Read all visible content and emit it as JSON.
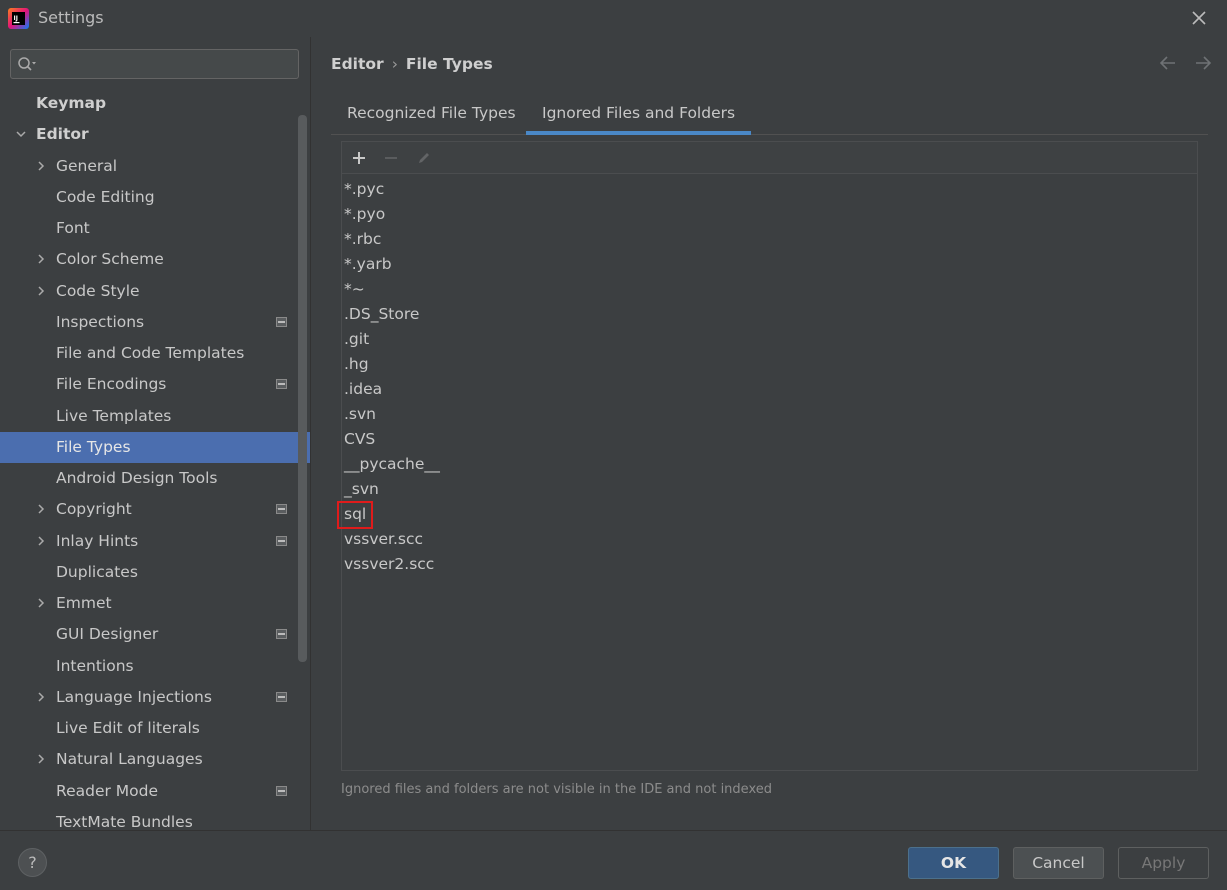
{
  "window": {
    "title": "Settings",
    "app_icon": "intellij-idea-icon",
    "close_icon": "close-icon"
  },
  "sidebar": {
    "search": {
      "value": "",
      "placeholder": "",
      "icon": "search-icon"
    },
    "items": [
      {
        "label": "Keymap",
        "level": 0,
        "expandable": false,
        "bold": true,
        "project_icon": false,
        "selected": false
      },
      {
        "label": "Editor",
        "level": 0,
        "expandable": true,
        "expanded": true,
        "bold": true,
        "project_icon": false,
        "selected": false
      },
      {
        "label": "General",
        "level": 1,
        "expandable": true,
        "project_icon": false,
        "selected": false
      },
      {
        "label": "Code Editing",
        "level": 1,
        "expandable": false,
        "project_icon": false,
        "selected": false
      },
      {
        "label": "Font",
        "level": 1,
        "expandable": false,
        "project_icon": false,
        "selected": false
      },
      {
        "label": "Color Scheme",
        "level": 1,
        "expandable": true,
        "project_icon": false,
        "selected": false
      },
      {
        "label": "Code Style",
        "level": 1,
        "expandable": true,
        "project_icon": false,
        "selected": false
      },
      {
        "label": "Inspections",
        "level": 1,
        "expandable": false,
        "project_icon": true,
        "selected": false
      },
      {
        "label": "File and Code Templates",
        "level": 1,
        "expandable": false,
        "project_icon": false,
        "selected": false
      },
      {
        "label": "File Encodings",
        "level": 1,
        "expandable": false,
        "project_icon": true,
        "selected": false
      },
      {
        "label": "Live Templates",
        "level": 1,
        "expandable": false,
        "project_icon": false,
        "selected": false
      },
      {
        "label": "File Types",
        "level": 1,
        "expandable": false,
        "project_icon": false,
        "selected": true
      },
      {
        "label": "Android Design Tools",
        "level": 1,
        "expandable": false,
        "project_icon": false,
        "selected": false
      },
      {
        "label": "Copyright",
        "level": 1,
        "expandable": true,
        "project_icon": true,
        "selected": false
      },
      {
        "label": "Inlay Hints",
        "level": 1,
        "expandable": true,
        "project_icon": true,
        "selected": false
      },
      {
        "label": "Duplicates",
        "level": 1,
        "expandable": false,
        "project_icon": false,
        "selected": false
      },
      {
        "label": "Emmet",
        "level": 1,
        "expandable": true,
        "project_icon": false,
        "selected": false
      },
      {
        "label": "GUI Designer",
        "level": 1,
        "expandable": false,
        "project_icon": true,
        "selected": false
      },
      {
        "label": "Intentions",
        "level": 1,
        "expandable": false,
        "project_icon": false,
        "selected": false
      },
      {
        "label": "Language Injections",
        "level": 1,
        "expandable": true,
        "project_icon": true,
        "selected": false
      },
      {
        "label": "Live Edit of literals",
        "level": 1,
        "expandable": false,
        "project_icon": false,
        "selected": false
      },
      {
        "label": "Natural Languages",
        "level": 1,
        "expandable": true,
        "project_icon": false,
        "selected": false
      },
      {
        "label": "Reader Mode",
        "level": 1,
        "expandable": false,
        "project_icon": true,
        "selected": false
      },
      {
        "label": "TextMate Bundles",
        "level": 1,
        "expandable": false,
        "project_icon": false,
        "selected": false
      }
    ]
  },
  "main": {
    "breadcrumb": {
      "parent": "Editor",
      "separator": "›",
      "current": "File Types"
    },
    "nav": {
      "back_icon": "arrow-left-icon",
      "forward_icon": "arrow-right-icon"
    },
    "tabs": [
      {
        "label": "Recognized File Types",
        "active": false
      },
      {
        "label": "Ignored Files and Folders",
        "active": true
      }
    ],
    "toolbar": {
      "add_icon": "plus-icon",
      "remove_icon": "minus-icon",
      "edit_icon": "pencil-icon"
    },
    "ignored_list": [
      "*.pyc",
      "*.pyo",
      "*.rbc",
      "*.yarb",
      "*~",
      ".DS_Store",
      ".git",
      ".hg",
      ".idea",
      ".svn",
      "CVS",
      "__pycache__",
      "_svn",
      "sql",
      "vssver.scc",
      "vssver2.scc"
    ],
    "highlighted_item": "sql",
    "highlight_color": "#e01b1b",
    "footnote": "Ignored files and folders are not visible in the IDE and not indexed"
  },
  "footer": {
    "help_label": "?",
    "ok_label": "OK",
    "cancel_label": "Cancel",
    "apply_label": "Apply"
  },
  "colors": {
    "background": "#3c3f41",
    "selection": "#4b6eaf",
    "tab_underline": "#4a88c7",
    "ok_button": "#365880"
  }
}
